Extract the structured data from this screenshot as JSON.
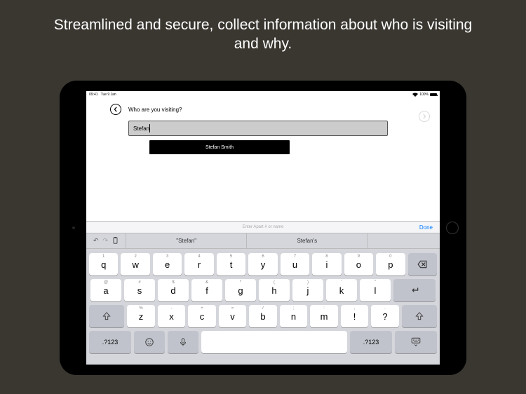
{
  "caption": "Streamlined and secure, collect information about who is visiting and why.",
  "status": {
    "time": "09:41",
    "date": "Tue 9 Jan",
    "battery": "100%"
  },
  "app": {
    "prompt": "Who are you visiting?",
    "input_value": "Stefan",
    "result": "Stefan Smith"
  },
  "keyboard": {
    "placeholder": "Enter Apart # or name",
    "done": "Done",
    "suggestions": [
      "\"Stefan\"",
      "Stefan's"
    ],
    "row1": [
      {
        "main": "q",
        "alt": "1"
      },
      {
        "main": "w",
        "alt": "2"
      },
      {
        "main": "e",
        "alt": "3"
      },
      {
        "main": "r",
        "alt": "4"
      },
      {
        "main": "t",
        "alt": "5"
      },
      {
        "main": "y",
        "alt": "6"
      },
      {
        "main": "u",
        "alt": "7"
      },
      {
        "main": "i",
        "alt": "8"
      },
      {
        "main": "o",
        "alt": "9"
      },
      {
        "main": "p",
        "alt": "0"
      }
    ],
    "row2": [
      {
        "main": "a",
        "alt": "@"
      },
      {
        "main": "s",
        "alt": "#"
      },
      {
        "main": "d",
        "alt": "$"
      },
      {
        "main": "f",
        "alt": "&"
      },
      {
        "main": "g",
        "alt": "*"
      },
      {
        "main": "h",
        "alt": "("
      },
      {
        "main": "j",
        "alt": ")"
      },
      {
        "main": "k",
        "alt": "'"
      },
      {
        "main": "l",
        "alt": "\""
      }
    ],
    "row3": [
      {
        "main": "z",
        "alt": "%"
      },
      {
        "main": "x",
        "alt": "-"
      },
      {
        "main": "c",
        "alt": "+"
      },
      {
        "main": "v",
        "alt": "="
      },
      {
        "main": "b",
        "alt": "/"
      },
      {
        "main": "n",
        "alt": ";"
      },
      {
        "main": "m",
        "alt": ":"
      },
      {
        "main": "!",
        "alt": ","
      },
      {
        "main": "?",
        "alt": "."
      }
    ],
    "mode_key": ".?123"
  }
}
